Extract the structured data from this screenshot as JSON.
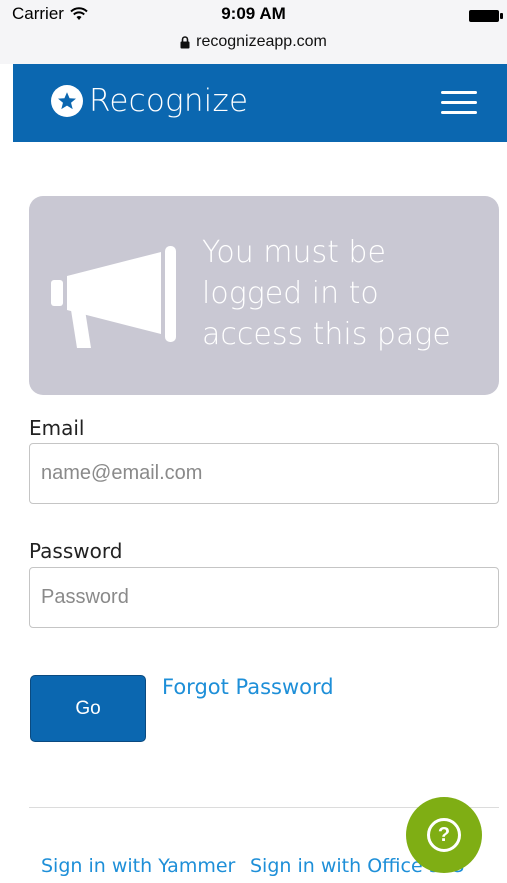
{
  "status_bar": {
    "carrier": "Carrier",
    "time": "9:09 AM",
    "url": "recognizeapp.com"
  },
  "navbar": {
    "brand": "Recognize",
    "accent_color": "#0b67b0"
  },
  "notice": {
    "message": "You must be logged in to access this page",
    "icon": "megaphone-icon"
  },
  "form": {
    "email_label": "Email",
    "email_placeholder": "name@email.com",
    "password_label": "Password",
    "password_placeholder": "Password",
    "submit_label": "Go",
    "forgot_label": "Forgot Password"
  },
  "footer": {
    "yammer_label": "Sign in with Yammer",
    "office_label": "Sign in with Office 365",
    "help_label": "?"
  }
}
